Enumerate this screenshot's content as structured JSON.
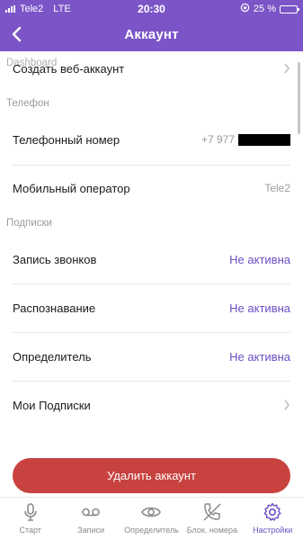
{
  "status": {
    "carrier": "Tele2",
    "network": "LTE",
    "time": "20:30",
    "battery": "25 %",
    "battery_level": 0.25
  },
  "header": {
    "title": "Аккаунт",
    "back_icon": "chevron-left-icon"
  },
  "account": {
    "dashboard_label": "Dashboard",
    "create_web_label": "Создать веб-аккаунт",
    "phone_section": "Телефон",
    "phone_number_label": "Телефонный номер",
    "phone_number_value": "+7 977",
    "operator_label": "Мобильный оператор",
    "operator_value": "Tele2",
    "subscriptions_section": "Подписки",
    "items": [
      {
        "label": "Запись звонков",
        "value": "Не активна"
      },
      {
        "label": "Распознавание",
        "value": "Не активна"
      },
      {
        "label": "Определитель",
        "value": "Не активна"
      }
    ],
    "my_subscriptions_label": "Мои Подписки",
    "delete_button": "Удалить аккаунт"
  },
  "tabs": [
    {
      "label": "Старт",
      "icon": "microphone-icon",
      "active": false
    },
    {
      "label": "Записи",
      "icon": "voicemail-icon",
      "active": false
    },
    {
      "label": "Определитель",
      "icon": "eye-icon",
      "active": false
    },
    {
      "label": "Блок. номера",
      "icon": "phone-blocked-icon",
      "active": false
    },
    {
      "label": "Настройки",
      "icon": "gear-icon",
      "active": true
    }
  ],
  "colors": {
    "accent": "#7b55c7",
    "link": "#6a4fc4",
    "danger": "#c8423f"
  }
}
